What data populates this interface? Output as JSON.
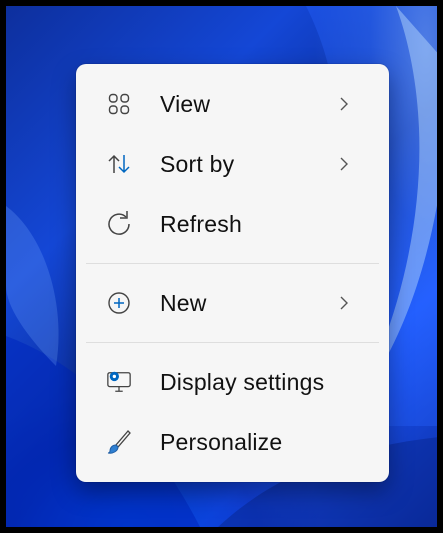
{
  "context_menu": {
    "items": [
      {
        "label": "View",
        "icon": "grid-icon",
        "has_submenu": true
      },
      {
        "label": "Sort by",
        "icon": "sort-arrows-icon",
        "has_submenu": true
      },
      {
        "label": "Refresh",
        "icon": "refresh-icon",
        "has_submenu": false
      },
      {
        "label": "New",
        "icon": "plus-circle-icon",
        "has_submenu": true
      },
      {
        "label": "Display settings",
        "icon": "display-settings-icon",
        "has_submenu": false
      },
      {
        "label": "Personalize",
        "icon": "brush-icon",
        "has_submenu": false
      }
    ]
  },
  "colors": {
    "menu_background": "#f6f6f6",
    "accent_blue": "#0067c0",
    "icon_gray": "#555555"
  }
}
